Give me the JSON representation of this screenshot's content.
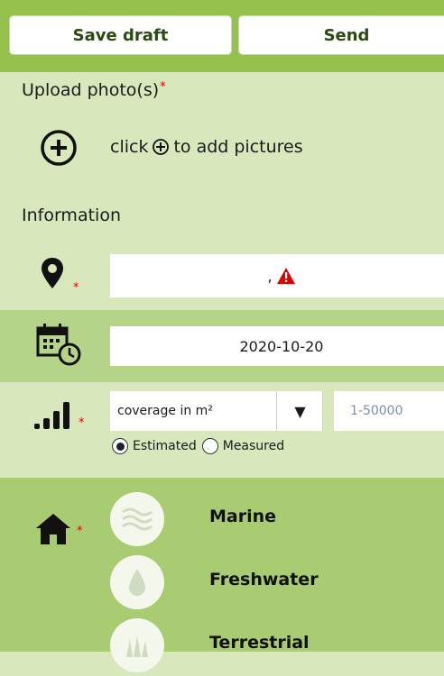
{
  "toolbar": {
    "save_draft_label": "Save draft",
    "send_label": "Send"
  },
  "upload": {
    "title": "Upload photo(s)",
    "required_mark": "*",
    "hint_before": "click",
    "hint_after": "to add pictures"
  },
  "information": {
    "title": "Information"
  },
  "location": {
    "value": ",",
    "required_mark": "*",
    "warning_icon": "warning-triangle-icon"
  },
  "date": {
    "value": "2020-10-20",
    "icon": "calendar-clock-icon"
  },
  "coverage": {
    "required_mark": "*",
    "unit_select": "coverage in m²",
    "range_placeholder": "1-50000",
    "options": [
      {
        "label": "Estimated",
        "selected": true
      },
      {
        "label": "Measured",
        "selected": false
      }
    ]
  },
  "habitat": {
    "required_mark": "*",
    "items": [
      {
        "label": "Marine",
        "icon": "waves-icon"
      },
      {
        "label": "Freshwater",
        "icon": "water-drop-icon"
      },
      {
        "label": "Terrestrial",
        "icon": "grass-icon"
      }
    ]
  },
  "colors": {
    "topbar": "#94c24d",
    "panel": "#d8e8bc",
    "band": "#b5d48a",
    "habitat_band": "#a9cc72",
    "required": "#e00000",
    "warning": "#e00000"
  }
}
